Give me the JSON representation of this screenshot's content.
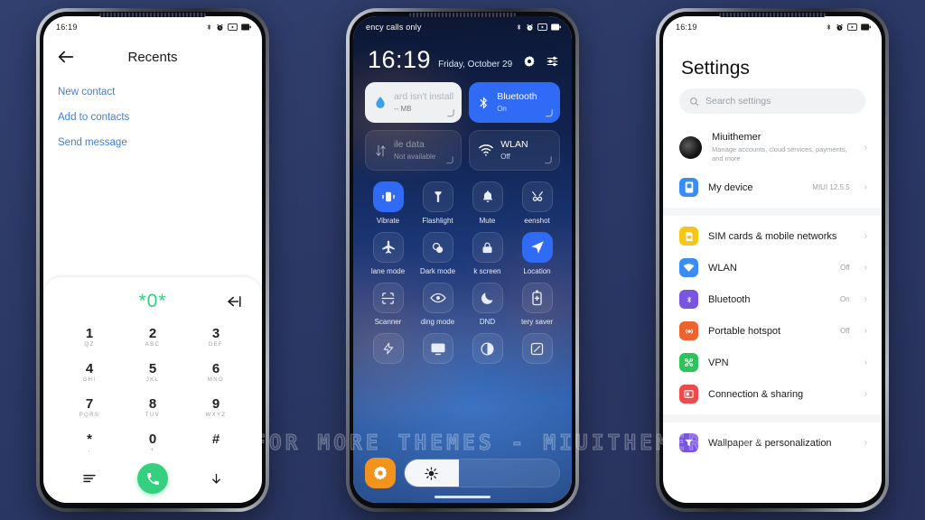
{
  "background_color": "#2c3d70",
  "watermark": "VISIT FOR MORE THEMES - MIUITHEMER.COM",
  "phone_left": {
    "status_bar": {
      "time": "16:19",
      "icons": [
        "bluetooth-icon",
        "alarm-icon",
        "screen-record-icon",
        "battery-icon"
      ]
    },
    "dialer": {
      "title": "Recents",
      "back_icon": "back-arrow-icon",
      "quick_actions": [
        "New contact",
        "Add to contacts",
        "Send message"
      ],
      "entry": "*0*",
      "backspace_icon": "backspace-icon",
      "keys": [
        {
          "digit": "1",
          "letters": "QZ"
        },
        {
          "digit": "2",
          "letters": "ABC"
        },
        {
          "digit": "3",
          "letters": "DEF"
        },
        {
          "digit": "4",
          "letters": "GHI"
        },
        {
          "digit": "5",
          "letters": "JKL"
        },
        {
          "digit": "6",
          "letters": "MNO"
        },
        {
          "digit": "7",
          "letters": "PQRS"
        },
        {
          "digit": "8",
          "letters": "TUV"
        },
        {
          "digit": "9",
          "letters": "WXYZ"
        },
        {
          "digit": "*",
          "letters": ","
        },
        {
          "digit": "0",
          "letters": "+"
        },
        {
          "digit": "#",
          "letters": ""
        }
      ],
      "bottom": {
        "menu_icon": "menu-icon",
        "call_icon": "call-icon",
        "hide_icon": "hide-dialpad-icon"
      },
      "accent_green": "#35d07f",
      "link_blue": "#3d7fe0"
    }
  },
  "phone_middle": {
    "status_bar": {
      "carrier": "ency calls only",
      "icons": [
        "bluetooth-icon",
        "alarm-icon",
        "screen-record-icon",
        "battery-icon"
      ]
    },
    "clock": {
      "time": "16:19",
      "date": "Friday, October 29"
    },
    "header_icons": [
      "brightness-auto-icon",
      "settings-sliders-icon"
    ],
    "big_tiles": [
      {
        "name": "sim-card",
        "title": "ard isn't install",
        "sub": "-- MB",
        "icon": "water-drop-icon",
        "state": "white"
      },
      {
        "name": "bluetooth",
        "title": "Bluetooth",
        "sub": "On",
        "icon": "bluetooth-icon",
        "state": "on"
      },
      {
        "name": "mobile-data",
        "title": "ile data",
        "sub": "Not available",
        "icon": "mobile-data-icon",
        "state": "disabled"
      },
      {
        "name": "wlan",
        "title": "WLAN",
        "sub": "Off",
        "icon": "wifi-icon",
        "state": "off"
      }
    ],
    "toggles": [
      {
        "label": "Vibrate",
        "icon": "vibrate-icon",
        "active": true
      },
      {
        "label": "Flashlight",
        "icon": "flashlight-icon",
        "active": false
      },
      {
        "label": "Mute",
        "icon": "bell-icon",
        "active": false
      },
      {
        "label": "eenshot",
        "icon": "screenshot-icon",
        "active": false
      },
      {
        "label": "lane mode",
        "icon": "airplane-icon",
        "active": false
      },
      {
        "label": "Dark mode",
        "icon": "dark-mode-icon",
        "active": false
      },
      {
        "label": "k screen",
        "icon": "lock-icon",
        "active": false
      },
      {
        "label": "Location",
        "icon": "location-icon",
        "active": true
      },
      {
        "label": "Scanner",
        "icon": "scanner-icon",
        "active": false
      },
      {
        "label": "ding mode",
        "icon": "eye-icon",
        "active": false
      },
      {
        "label": "DND",
        "icon": "moon-icon",
        "active": false
      },
      {
        "label": "tery saver",
        "icon": "battery-saver-icon",
        "active": false
      },
      {
        "label": "",
        "icon": "lightning-icon",
        "active": false
      },
      {
        "label": "",
        "icon": "cast-icon",
        "active": false
      },
      {
        "label": "",
        "icon": "contrast-icon",
        "active": false
      },
      {
        "label": "",
        "icon": "expand-icon",
        "active": false
      }
    ],
    "brightness": {
      "auto_icon": "brightness-auto-icon",
      "slider_icon": "sun-icon",
      "percent": 35
    },
    "accent_blue": "#2f6bf5",
    "accent_orange": "#f2931e"
  },
  "phone_right": {
    "status_bar": {
      "time": "16:19",
      "icons": [
        "bluetooth-icon",
        "alarm-icon",
        "screen-record-icon",
        "battery-icon"
      ]
    },
    "title": "Settings",
    "search": {
      "placeholder": "Search settings",
      "icon": "search-icon"
    },
    "account": {
      "name": "Miuithemer",
      "subtitle": "Manage accounts, cloud services, payments, and more",
      "icon": "avatar"
    },
    "device": {
      "label": "My device",
      "value": "MIUI 12.5.5",
      "icon": "device-icon",
      "color": "#3a8bf5"
    },
    "items": [
      {
        "label": "SIM cards & mobile networks",
        "value": "",
        "icon": "sim-icon",
        "color": "#f5c518"
      },
      {
        "label": "WLAN",
        "value": "Off",
        "icon": "wifi-icon",
        "color": "#3a8bf5"
      },
      {
        "label": "Bluetooth",
        "value": "On",
        "icon": "bluetooth-icon",
        "color": "#7a55e0"
      },
      {
        "label": "Portable hotspot",
        "value": "Off",
        "icon": "hotspot-icon",
        "color": "#f0622c"
      },
      {
        "label": "VPN",
        "value": "",
        "icon": "vpn-icon",
        "color": "#2fc25b"
      },
      {
        "label": "Connection & sharing",
        "value": "",
        "icon": "connection-icon",
        "color": "#ef4b4b"
      }
    ],
    "items2": [
      {
        "label": "Wallpaper & personalization",
        "value": "",
        "icon": "wallpaper-icon",
        "color": "#7a55e0"
      }
    ],
    "chevron": "›"
  }
}
